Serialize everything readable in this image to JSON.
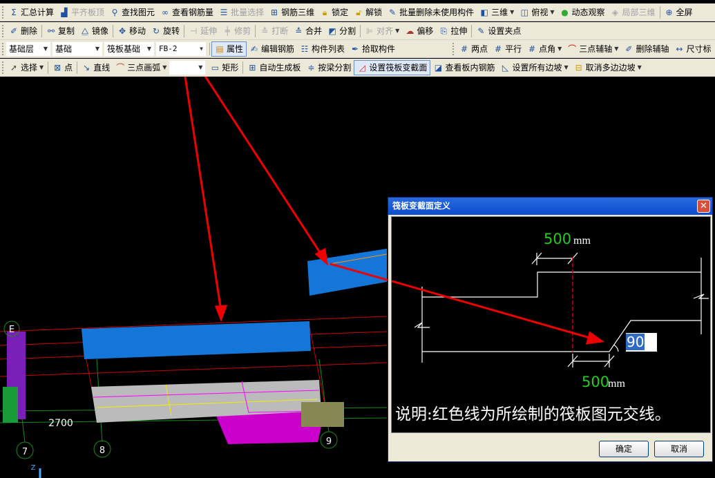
{
  "toolbar1": {
    "sum": "汇总计算",
    "flat": "平齐板顶",
    "find": "查找图元",
    "view_rebar": "查看钢筋量",
    "batch_select": "批量选择",
    "rebar3d": "钢筋三维",
    "lock": "锁定",
    "unlock": "解锁",
    "batch_delete": "批量删除未使用构件",
    "view3d": "三维",
    "top_view": "俯视",
    "orbit": "动态观察",
    "partial3d": "局部三维",
    "fullscreen": "全屏"
  },
  "toolbar2": {
    "delete": "删除",
    "copy": "复制",
    "mirror": "镜像",
    "move": "移动",
    "rotate": "旋转",
    "extend": "延伸",
    "trim": "修剪",
    "break": "打断",
    "merge": "合并",
    "split": "分割",
    "align": "对齐",
    "offset": "偏移",
    "stretch": "拉伸",
    "grip": "设置夹点"
  },
  "toolbar3": {
    "layer": "基础层",
    "category": "基础",
    "type": "筏板基础",
    "component": "FB-2",
    "properties": "属性",
    "edit_rebar": "编辑钢筋",
    "component_list": "构件列表",
    "pick": "拾取构件",
    "two_point": "两点",
    "parallel": "平行",
    "point_angle": "点角",
    "three_point_axis": "三点辅轴",
    "delete_axis": "删除辅轴",
    "dimension": "尺寸标"
  },
  "toolbar4": {
    "select": "选择",
    "point": "点",
    "line": "直线",
    "arc": "三点画弧",
    "rect": "矩形",
    "auto_slab": "自动生成板",
    "split_by_beam": "按梁分割",
    "set_section": "设置筏板变截面",
    "view_slab_rebar": "查看板内钢筋",
    "set_all_slopes": "设置所有边坡",
    "cancel_slopes": "取消多边边坡"
  },
  "canvas": {
    "axis_e": "E",
    "axis_7": "7",
    "axis_8": "8",
    "axis_9": "9",
    "dim": "2700",
    "z": "Z"
  },
  "dialog": {
    "title": "筏板变截面定义",
    "dim_top": "500",
    "dim_top_unit": "mm",
    "dim_bottom": "500",
    "dim_bottom_unit": "mm",
    "angle": "90",
    "note": "说明:红色线为所绘制的筏板图元交线。",
    "ok": "确定",
    "cancel": "取消"
  }
}
